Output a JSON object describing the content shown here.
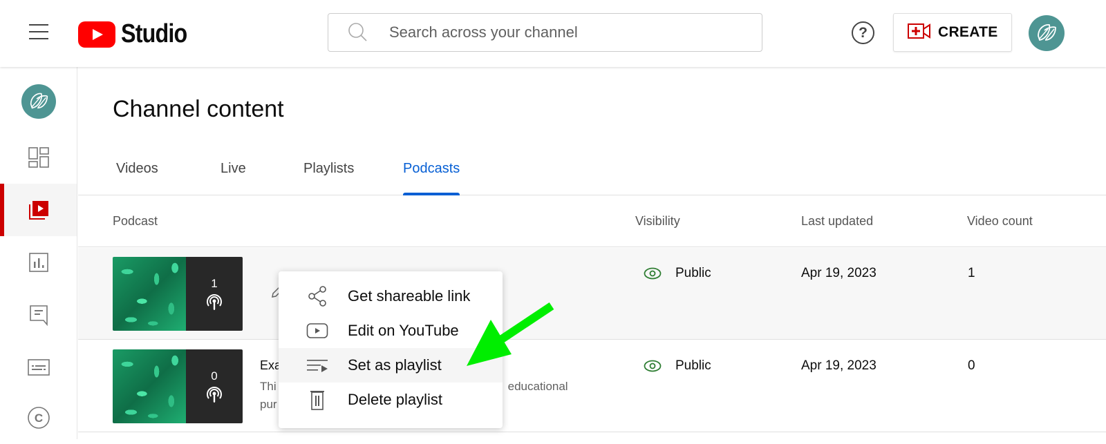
{
  "topbar": {
    "logo_text": "Studio",
    "search_placeholder": "Search across your channel",
    "help_glyph": "?",
    "create_label": "CREATE"
  },
  "sidebar": {
    "items": [
      {
        "name": "dashboard",
        "icon": "dashboard-icon"
      },
      {
        "name": "content",
        "icon": "content-icon",
        "active": true
      },
      {
        "name": "analytics",
        "icon": "analytics-icon"
      },
      {
        "name": "comments",
        "icon": "comments-icon"
      },
      {
        "name": "subtitles",
        "icon": "subtitles-icon"
      },
      {
        "name": "copyright",
        "icon": "copyright-icon"
      }
    ]
  },
  "main": {
    "title": "Channel content",
    "tabs": [
      {
        "label": "Videos"
      },
      {
        "label": "Live"
      },
      {
        "label": "Playlists"
      },
      {
        "label": "Podcasts",
        "active": true
      }
    ],
    "columns": {
      "podcast": "Podcast",
      "visibility": "Visibility",
      "last_updated": "Last updated",
      "video_count": "Video count"
    },
    "rows": [
      {
        "thumb_count": "1",
        "title": "",
        "description": "",
        "visibility": "Public",
        "last_updated": "Apr 19, 2023",
        "video_count": "1"
      },
      {
        "thumb_count": "0",
        "title": "Exa",
        "description_start": "Thi",
        "description_end": "educational",
        "description_line2": "pur",
        "visibility": "Public",
        "last_updated": "Apr 19, 2023",
        "video_count": "0"
      }
    ]
  },
  "context_menu": {
    "items": [
      {
        "label": "Get shareable link",
        "icon": "share-icon"
      },
      {
        "label": "Edit on YouTube",
        "icon": "youtube-icon"
      },
      {
        "label": "Set as playlist",
        "icon": "playlist-icon",
        "highlighted": true
      },
      {
        "label": "Delete playlist",
        "icon": "trash-icon"
      }
    ]
  },
  "colors": {
    "accent_blue": "#065fd4",
    "brand_red": "#ff0000",
    "active_red": "#cc0000",
    "avatar_teal": "#4e9593",
    "public_green": "#2e7d32",
    "annotation_arrow": "#00ee00"
  }
}
